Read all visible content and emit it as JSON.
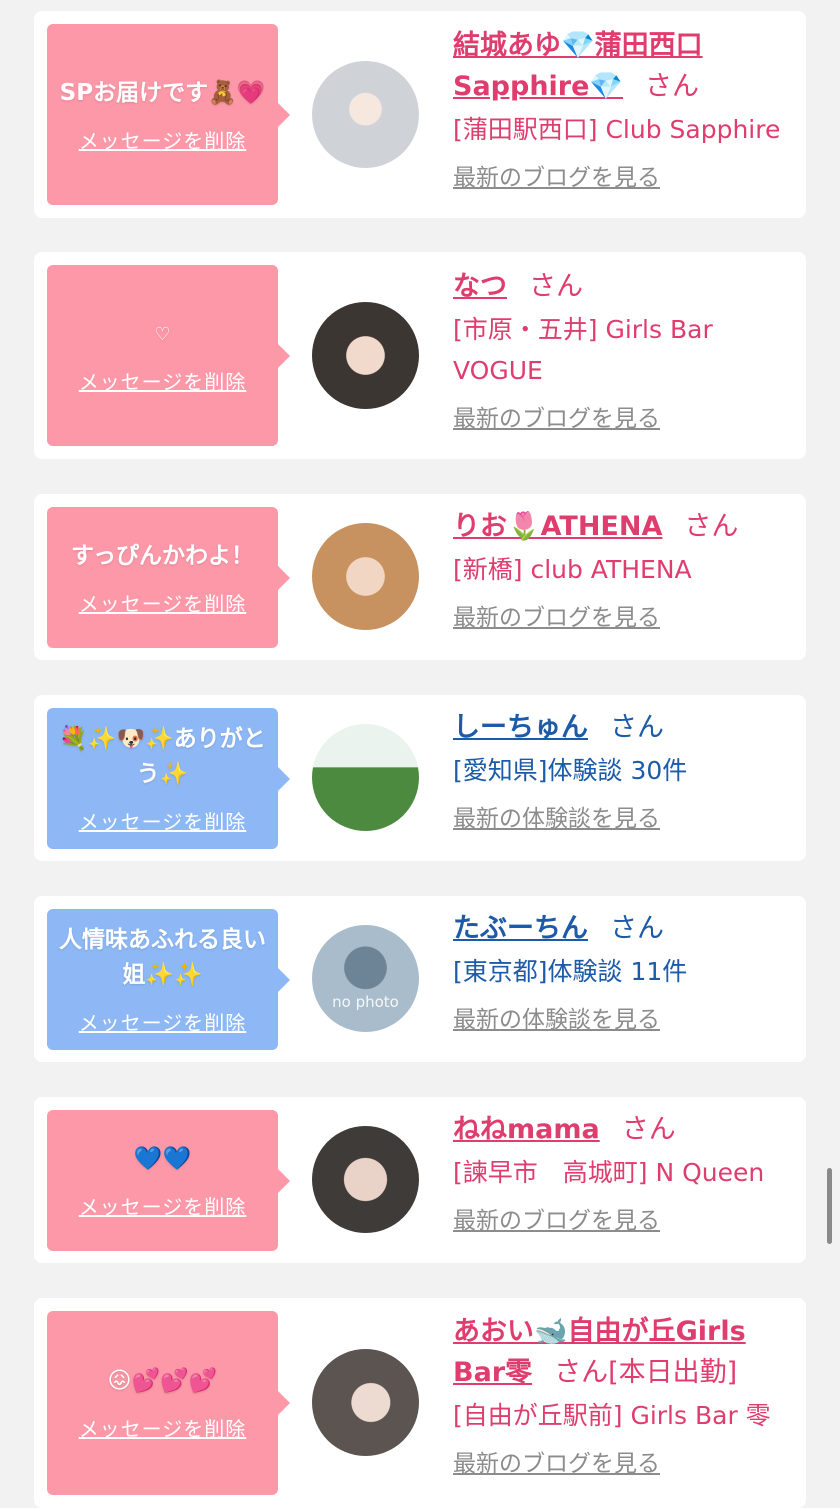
{
  "cards": [
    {
      "bubble": "pink",
      "message": "SPお届けです🧸💗",
      "delete_label": "メッセージを削除",
      "name": "結城あゆ💎蒲田西口Sapphire💎",
      "honorific": "さん",
      "extra": "",
      "shop": "[蒲田駅西口] Club Sapphire",
      "link": "最新のブログを見る",
      "name_color": "#e03d6f"
    },
    {
      "bubble": "pink",
      "message": "♡",
      "delete_label": "メッセージを削除",
      "name": "なつ",
      "honorific": "さん",
      "extra": "",
      "shop": "[市原・五井] Girls Bar VOGUE",
      "link": "最新のブログを見る",
      "name_color": "#e03d6f"
    },
    {
      "bubble": "pink",
      "message": "すっぴんかわよ！",
      "delete_label": "メッセージを削除",
      "name": "りお🌷ATHENA",
      "honorific": "さん",
      "extra": "",
      "shop": "[新橋] club ATHENA",
      "link": "最新のブログを見る",
      "name_color": "#e03d6f"
    },
    {
      "bubble": "blue",
      "message": "💐✨🐶✨ありがとう✨",
      "delete_label": "メッセージを削除",
      "name": "しーちゅん",
      "honorific": "さん",
      "extra": "",
      "shop": "[愛知県]体験談 30件",
      "link": "最新の体験談を見る",
      "name_color": "#1d5ba8"
    },
    {
      "bubble": "blue",
      "message": "人情味あふれる良い姐✨✨",
      "delete_label": "メッセージを削除",
      "name": "たぶーちん",
      "honorific": "さん",
      "extra": "",
      "shop": "[東京都]体験談 11件",
      "link": "最新の体験談を見る",
      "name_color": "#1d5ba8",
      "avatar_text": "no photo"
    },
    {
      "bubble": "pink",
      "message": "💙💙",
      "delete_label": "メッセージを削除",
      "name": "ねねmama",
      "honorific": "さん",
      "extra": "",
      "shop": "[諫早市　高城町] N Queen",
      "link": "最新のブログを見る",
      "name_color": "#e03d6f"
    },
    {
      "bubble": "pink",
      "message": "😖💕💕💕",
      "delete_label": "メッセージを削除",
      "name": "あおい🐋自由が丘Girls Bar零",
      "honorific": "さん",
      "extra": "[本日出勤]",
      "shop": "[自由が丘駅前] Girls Bar 零",
      "link": "最新のブログを見る",
      "name_color": "#e03d6f"
    }
  ]
}
